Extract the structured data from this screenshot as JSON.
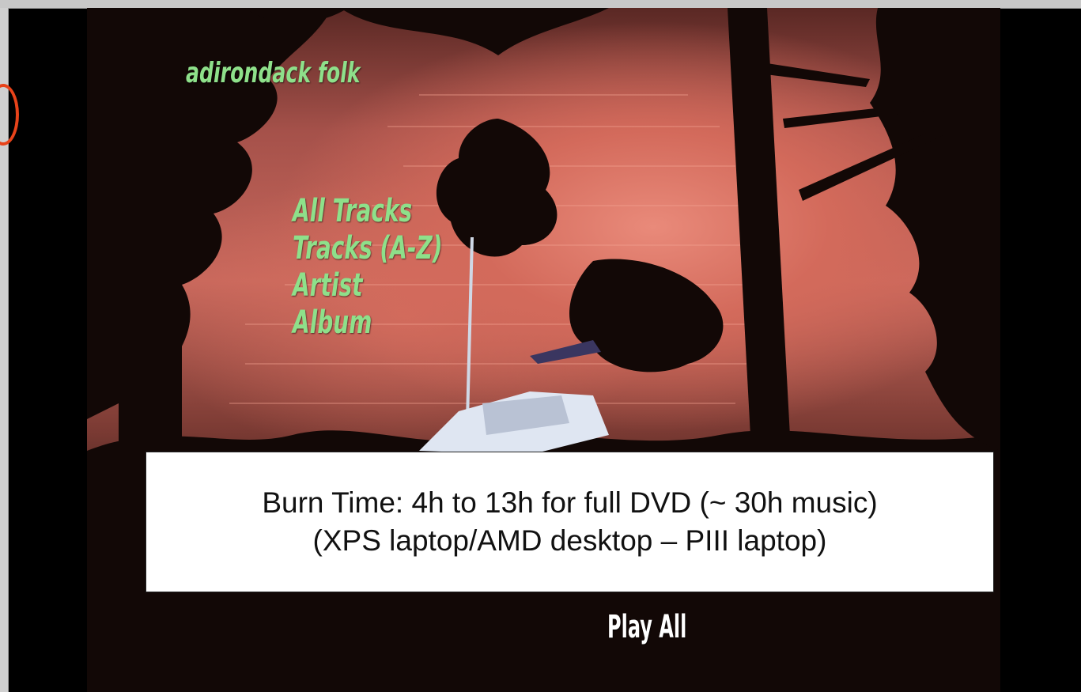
{
  "dvd_menu": {
    "title": "adirondack folk",
    "items": [
      "All Tracks",
      "Tracks (A-Z)",
      "Artist",
      "Album"
    ],
    "play_all": "Play All"
  },
  "callout": {
    "line1": "Burn Time: 4h to 13h for full DVD (~ 30h music)",
    "line2": "(XPS laptop/AMD desktop – PIII laptop)"
  },
  "colors": {
    "menu_text": "#8ee08a",
    "annotation_mark": "#e8431a",
    "callout_bg": "#ffffff"
  }
}
